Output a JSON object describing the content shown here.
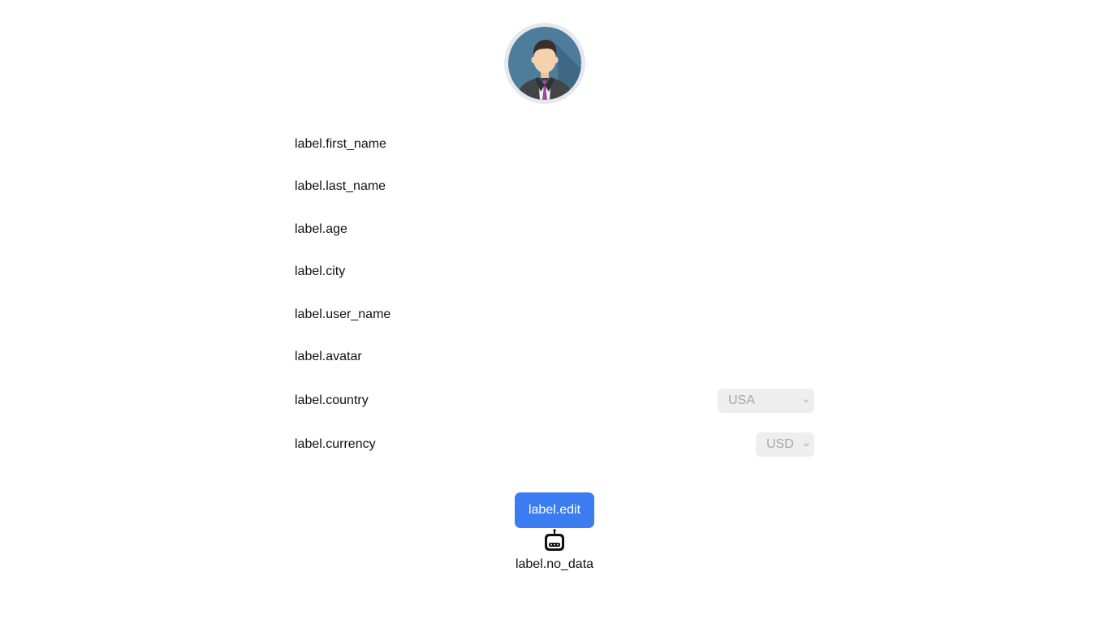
{
  "profile": {
    "avatar_icon": "user-avatar-businessman"
  },
  "fields": {
    "first_name": "label.first_name",
    "last_name": "label.last_name",
    "age": "label.age",
    "city": "label.city",
    "user_name": "label.user_name",
    "avatar": "label.avatar",
    "country": "label.country",
    "currency": "label.currency"
  },
  "selects": {
    "country_value": "USA",
    "currency_value": "USD"
  },
  "actions": {
    "edit_label": "label.edit"
  },
  "empty_state": {
    "icon": "robot-icon",
    "text": "label.no_data"
  },
  "colors": {
    "primary": "#3b7cf0",
    "disabled_bg": "#eeeeee",
    "disabled_text": "#a8a8a8"
  }
}
